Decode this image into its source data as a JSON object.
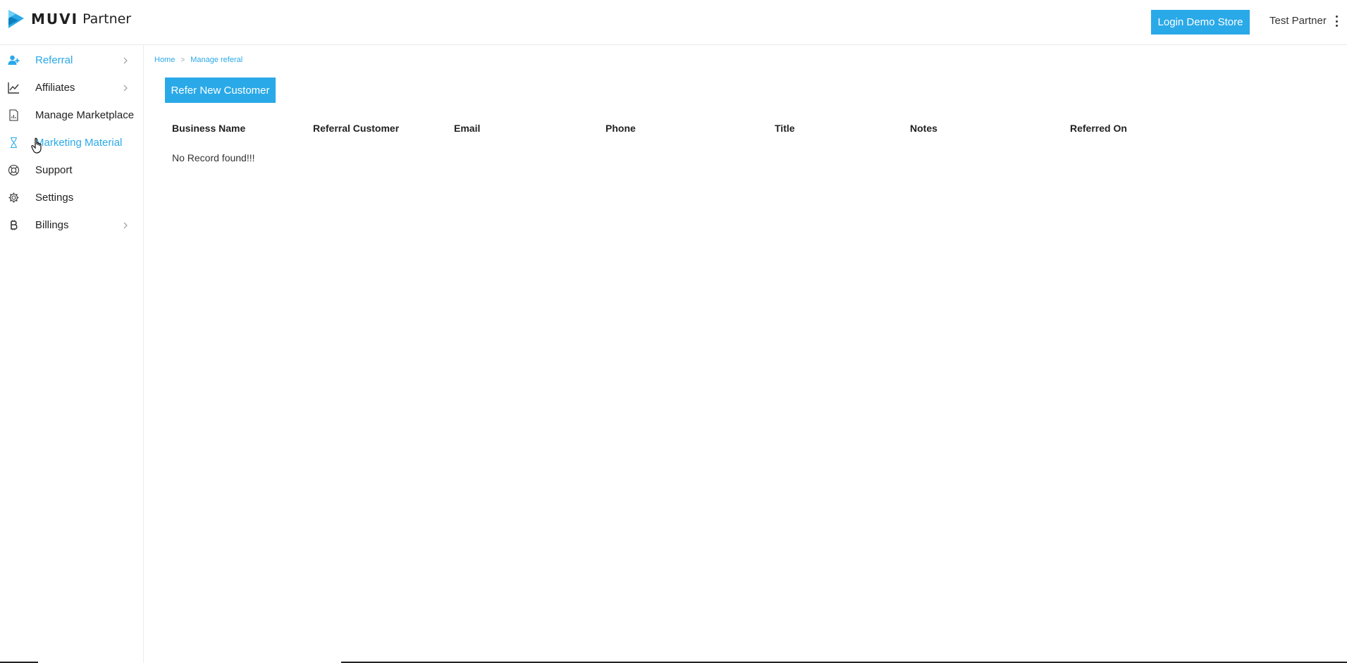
{
  "header": {
    "brand": "MUVI",
    "brand_sub": "Partner",
    "demo_button": "Login Demo Store",
    "user_name": "Test Partner",
    "accent_color": "#2aa9e8"
  },
  "sidebar": {
    "items": [
      {
        "label": "Referral",
        "icon": "add-user-icon",
        "active": true,
        "has_submenu": true
      },
      {
        "label": "Affiliates",
        "icon": "line-chart-icon",
        "active": false,
        "has_submenu": true
      },
      {
        "label": "Manage Marketplace",
        "icon": "document-chart-icon",
        "active": false,
        "has_submenu": false
      },
      {
        "label": "Marketing Material",
        "icon": "hourglass-icon",
        "active": true,
        "has_submenu": false
      },
      {
        "label": "Support",
        "icon": "lifebuoy-icon",
        "active": false,
        "has_submenu": false
      },
      {
        "label": "Settings",
        "icon": "gear-icon",
        "active": false,
        "has_submenu": false
      },
      {
        "label": "Billings",
        "icon": "bitcoin-icon",
        "active": false,
        "has_submenu": true
      }
    ]
  },
  "main": {
    "breadcrumb": [
      "Home",
      "Manage referal"
    ],
    "breadcrumb_separator": ">",
    "refer_button": "Refer New Customer",
    "table": {
      "columns": [
        "Business Name",
        "Referral Customer",
        "Email",
        "Phone",
        "Title",
        "Notes",
        "Referred On"
      ],
      "rows": [],
      "empty_message": "No Record found!!!"
    }
  }
}
